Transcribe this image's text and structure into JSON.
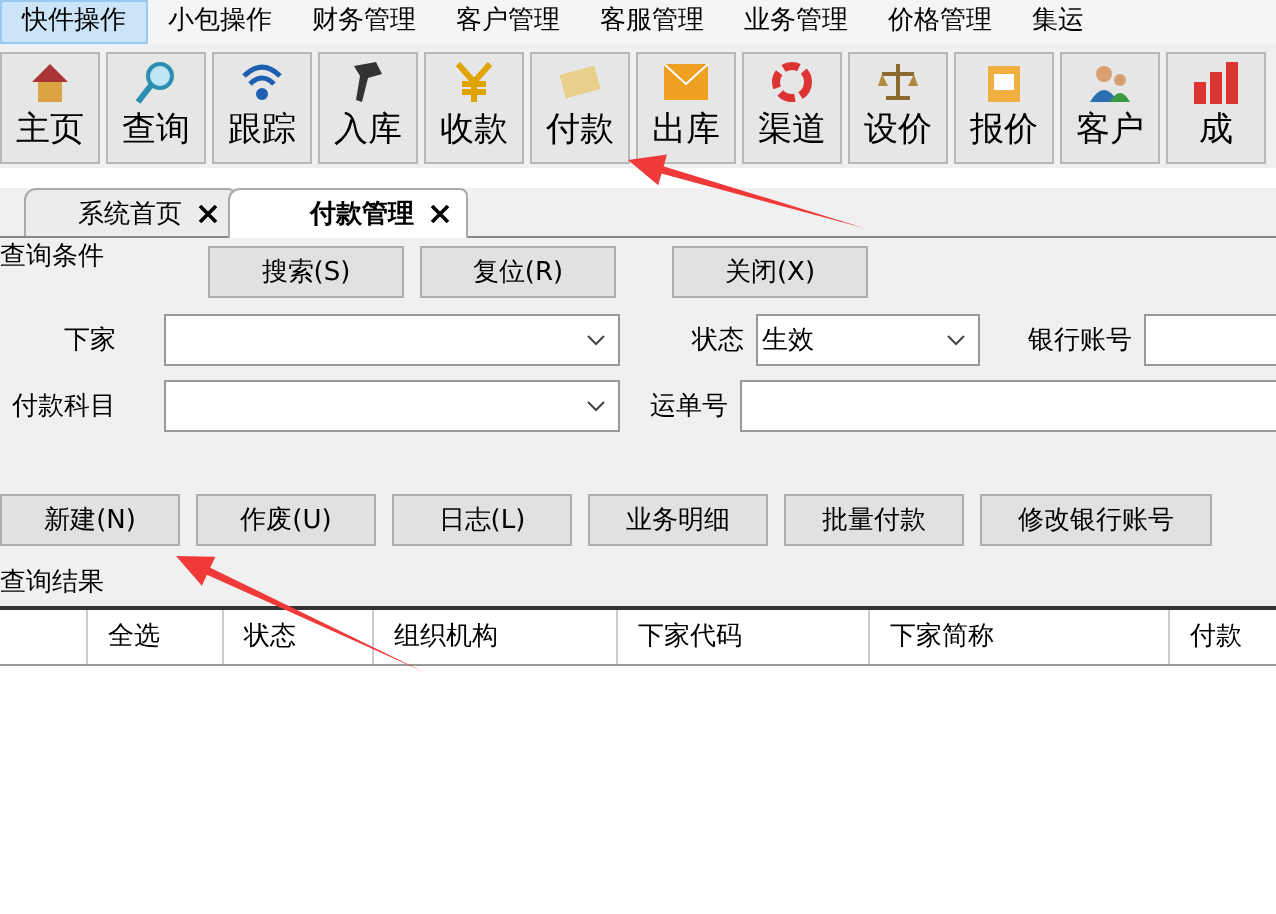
{
  "menu": [
    {
      "label": "快件操作",
      "selected": true
    },
    {
      "label": "小包操作",
      "selected": false
    },
    {
      "label": "财务管理",
      "selected": false
    },
    {
      "label": "客户管理",
      "selected": false
    },
    {
      "label": "客服管理",
      "selected": false
    },
    {
      "label": "业务管理",
      "selected": false
    },
    {
      "label": "价格管理",
      "selected": false
    },
    {
      "label": "集运",
      "selected": false
    }
  ],
  "toolbar": [
    "主页",
    "查询",
    "跟踪",
    "入库",
    "收款",
    "付款",
    "出库",
    "渠道",
    "设价",
    "报价",
    "客户",
    "成"
  ],
  "tabs": [
    {
      "label": "系统首页",
      "selected": false
    },
    {
      "label": "付款管理",
      "selected": true
    }
  ],
  "query": {
    "title": "查询条件",
    "buttons": [
      "搜索(S)",
      "复位(R)",
      "关闭(X)"
    ],
    "fields": [
      {
        "label": "下家",
        "kind": "combo"
      },
      {
        "label": "状态",
        "kind": "combo",
        "value": "生效"
      },
      {
        "label": "银行账号",
        "kind": "input"
      },
      {
        "label": "付款科目",
        "kind": "combo"
      },
      {
        "label": "运单号",
        "kind": "input"
      }
    ]
  },
  "actions": [
    "新建(N)",
    "作废(U)",
    "日志(L)",
    "业务明细",
    "批量付款",
    "修改银行账号"
  ],
  "results": {
    "title": "查询结果",
    "columns": [
      "全选",
      "状态",
      "组织机构",
      "下家代码",
      "下家简称",
      "付款"
    ]
  },
  "annotations": [
    {
      "kind": "arrow"
    },
    {
      "kind": "arrow"
    }
  ]
}
